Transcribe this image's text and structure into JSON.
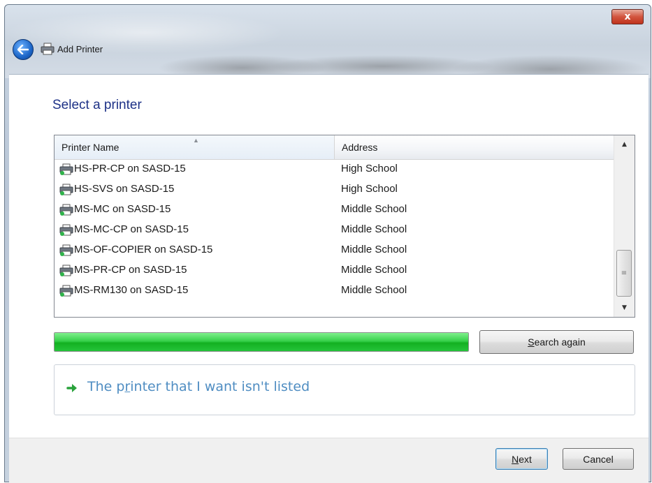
{
  "window": {
    "title": "Add Printer",
    "close_glyph": "x"
  },
  "heading": "Select a printer",
  "list": {
    "columns": {
      "name": "Printer Name",
      "address": "Address"
    },
    "rows": [
      {
        "name": "HS-PR-CP on SASD-15",
        "address": "High School"
      },
      {
        "name": "HS-SVS on SASD-15",
        "address": "High School"
      },
      {
        "name": "MS-MC on SASD-15",
        "address": "Middle School"
      },
      {
        "name": "MS-MC-CP on SASD-15",
        "address": "Middle School"
      },
      {
        "name": "MS-OF-COPIER on SASD-15",
        "address": "Middle School"
      },
      {
        "name": "MS-PR-CP on SASD-15",
        "address": "Middle School"
      },
      {
        "name": "MS-RM130 on SASD-15",
        "address": "Middle School"
      }
    ]
  },
  "progress": {
    "fraction": 1.0
  },
  "buttons": {
    "search_again": {
      "accel": "S",
      "rest": "earch again"
    },
    "next": {
      "accel": "N",
      "rest": "ext"
    },
    "cancel": "Cancel"
  },
  "command_link": {
    "pre": "The p",
    "accel": "r",
    "post": "inter that I want isn't listed"
  },
  "icons": {
    "back": "back-arrow-icon",
    "printer": "printer-icon",
    "command_arrow": "green-arrow-icon"
  },
  "colors": {
    "heading": "#1e3287",
    "link": "#4f8dc2",
    "progress": "#13b021",
    "close": "#c0331c"
  }
}
